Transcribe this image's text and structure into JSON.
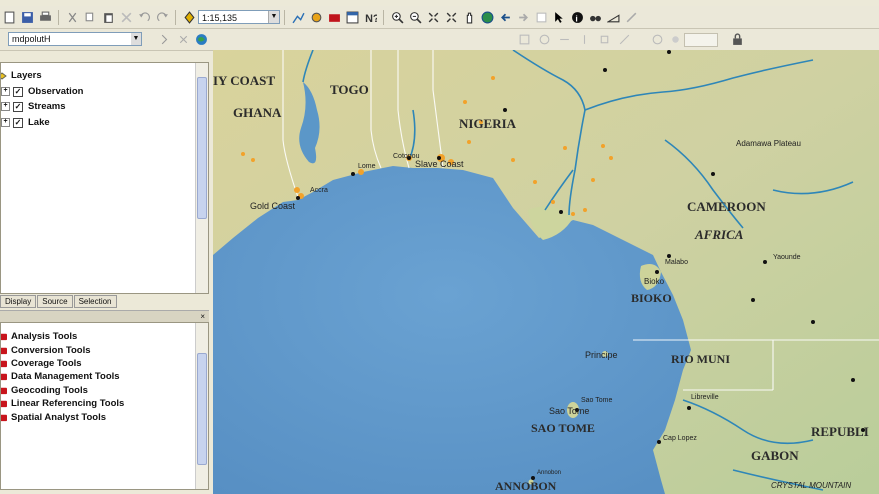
{
  "toolbar": {
    "scale_value": "1:15,135",
    "icons": [
      "new-doc-icon",
      "save-icon",
      "print-icon",
      "cut-icon",
      "undo-icon",
      "redo-icon",
      "add-data-icon",
      "zoom-in-icon",
      "zoom-out-icon",
      "pan-icon",
      "globe-icon",
      "select-icon",
      "identify-icon",
      "find-icon",
      "measure-icon"
    ]
  },
  "editor": {
    "layer_dropdown": "mdpolutH"
  },
  "toc": {
    "root_label": "Layers",
    "layers": [
      {
        "label": "Observation",
        "checked": true
      },
      {
        "label": "Streams",
        "checked": true
      },
      {
        "label": "Lake",
        "checked": true
      }
    ],
    "tabs": [
      "Display",
      "Source",
      "Selection"
    ]
  },
  "toolbox": {
    "items": [
      "Analysis Tools",
      "Conversion Tools",
      "Coverage Tools",
      "Data Management Tools",
      "Geocoding Tools",
      "Linear Referencing Tools",
      "Spatial Analyst Tools"
    ]
  },
  "map": {
    "colors": {
      "ocean": "#5f95c6",
      "land": "#d6d3a0",
      "river": "#2e86b8",
      "border": "#ffffff"
    },
    "country_labels": {
      "ivory_coast": "IY COAST",
      "ghana": "GHANA",
      "togo": "TOGO",
      "nigeria": "NIGERIA",
      "cameroon": "CAMEROON",
      "africa": "AFRICA",
      "bioko": "BIOKO",
      "rio_muni": "RIO MUNI",
      "sao_tome": "SAO TOME",
      "gabon": "GABON",
      "annobon": "ANNOBON",
      "republic": "REPUBLI"
    },
    "place_labels": {
      "gold_coast": "Gold Coast",
      "accra": "Accra",
      "lome": "Lome",
      "cotonou": "Cotonou",
      "slave_coast": "Slave Coast",
      "adamawa": "Adamawa Plateau",
      "malabo": "Malabo",
      "bioko_peak": "Bioko",
      "yaounde": "Yaounde",
      "principe": "Principe",
      "sao_tome_city": "Sao Tome",
      "sao_tome_island": "Sao Tome",
      "libreville": "Libreville",
      "cap_lopez": "Cap Lopez",
      "crystal_mountains": "CRYSTAL MOUNTAIN",
      "annobon_town": "Annobon"
    }
  }
}
